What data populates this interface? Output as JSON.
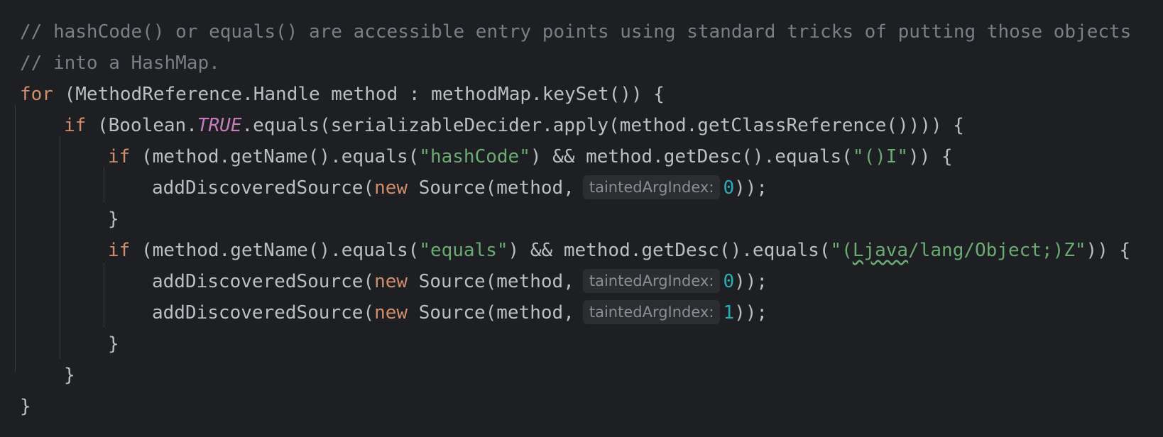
{
  "code": {
    "comment1": "// hashCode() or equals() are accessible entry points using standard tricks of putting those objects",
    "comment2": "// into a HashMap.",
    "kw_for": "for",
    "for_rest": " (MethodReference.Handle method : methodMap.keySet()) {",
    "kw_if": "if",
    "if1_pre": " (Boolean.",
    "const_true": "TRUE",
    "if1_post": ".equals(serializableDecider.apply(method.getClassReference()))) {",
    "if2_pre": " (method.getName().equals(",
    "str_hashcode": "\"hashCode\"",
    "if2_mid": ") && method.getDesc().equals(",
    "str_desc1": "\"()I\"",
    "if2_post": ")) {",
    "call_pre": "addDiscoveredSource(",
    "kw_new": "new",
    "call_mid": " Source(method,",
    "hint_label": "taintedArgIndex:",
    "arg0": "0",
    "arg1": "1",
    "call_post": "));",
    "close_brace": "}",
    "if3_pre": " (method.getName().equals(",
    "str_equals": "\"equals\"",
    "if3_mid": ") && method.getDesc().equals(",
    "str_desc2_a": "\"(",
    "str_desc2_b": "Ljava",
    "str_desc2_c": "/lang/Object;)Z\"",
    "if3_post": ")) {"
  }
}
